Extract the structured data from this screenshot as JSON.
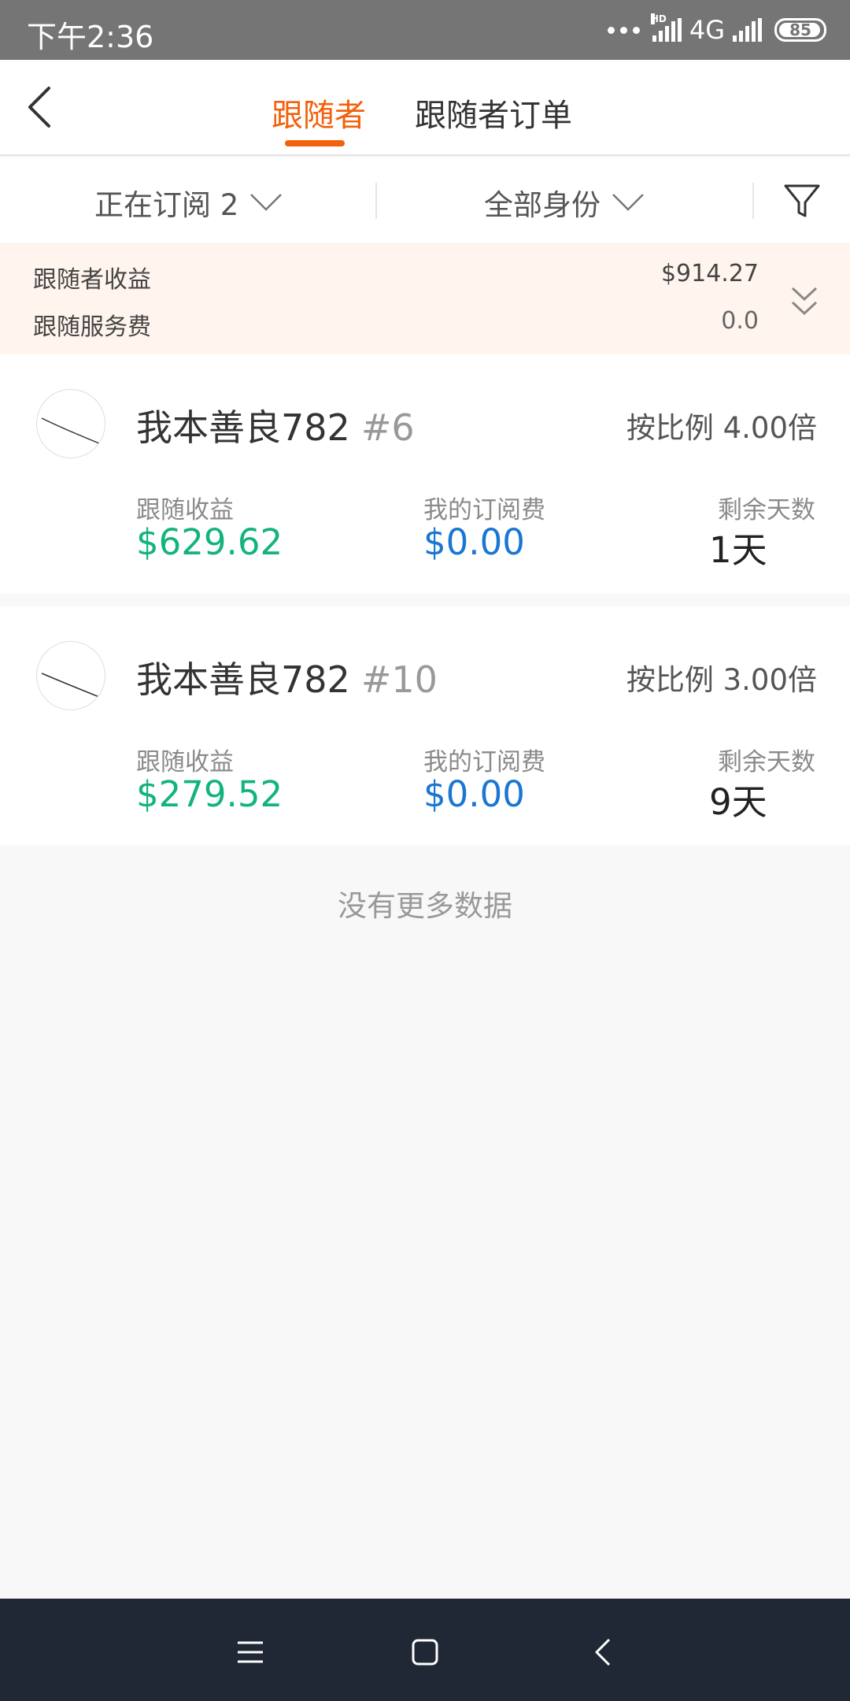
{
  "status_bar": {
    "time": "下午2:36",
    "hd": "HD",
    "network": "4G",
    "battery": "85"
  },
  "header": {
    "tabs": [
      {
        "label": "跟随者",
        "active": true
      },
      {
        "label": "跟随者订单",
        "active": false
      }
    ],
    "accent_color": "#f2610c"
  },
  "filters": {
    "subscription": "正在订阅 2",
    "role": "全部身份"
  },
  "summary": {
    "earnings_label": "跟随者收益",
    "earnings_value": "$914.27",
    "fee_label": "跟随服务费",
    "fee_value": "0.0"
  },
  "cards": [
    {
      "name": "我本善良782",
      "number": "#6",
      "ratio": "按比例 4.00倍",
      "earnings_label": "跟随收益",
      "earnings": "$629.62",
      "fee_label": "我的订阅费",
      "fee": "$0.00",
      "days_label": "剩余天数",
      "days": "1天"
    },
    {
      "name": "我本善良782",
      "number": "#10",
      "ratio": "按比例 3.00倍",
      "earnings_label": "跟随收益",
      "earnings": "$279.52",
      "fee_label": "我的订阅费",
      "fee": "$0.00",
      "days_label": "剩余天数",
      "days": "9天"
    }
  ],
  "footer_text": "没有更多数据",
  "colors": {
    "earnings_green": "#13b47b",
    "fee_blue": "#1977d2",
    "summary_bg": "#fff5ee"
  }
}
